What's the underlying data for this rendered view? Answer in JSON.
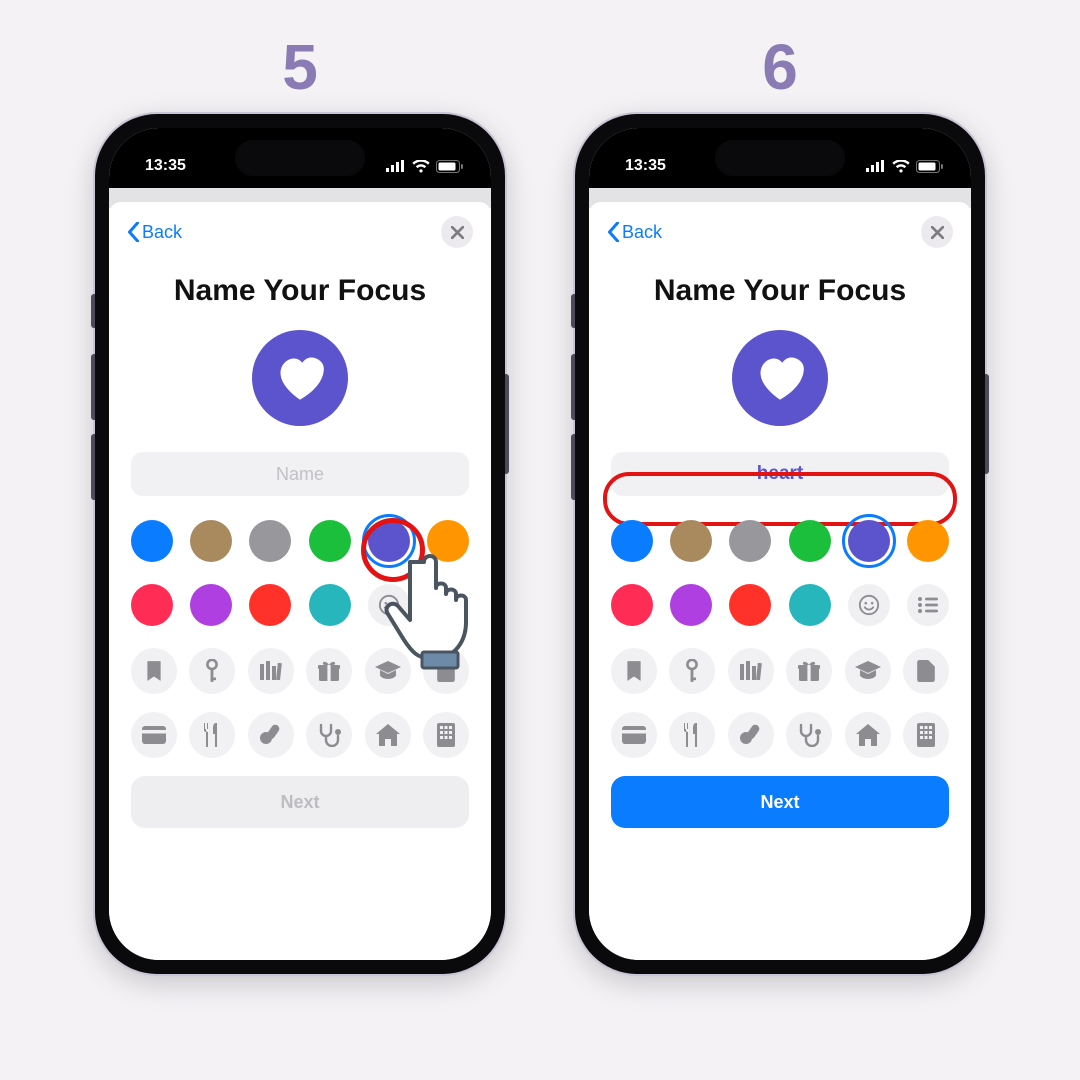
{
  "steps": {
    "left": "5",
    "right": "6"
  },
  "status": {
    "time": "13:35"
  },
  "nav": {
    "back_label": "Back"
  },
  "title": "Name Your Focus",
  "icon_accent": "#5b54cd",
  "name_field": {
    "placeholder": "Name",
    "value_right": "heart"
  },
  "colors_row1": [
    "#0a7cff",
    "#a88a5e",
    "#98989c",
    "#1bbf3c",
    "#5b54cd",
    "#ff9500"
  ],
  "colors_row2": [
    "#ff2d55",
    "#af3fe0",
    "#ff3129",
    "#28b6bd"
  ],
  "selected_color_index": 4,
  "extra_row2_icons": [
    "smiley-icon",
    "list-icon"
  ],
  "glyph_rows": [
    [
      "bookmark-icon",
      "key-icon",
      "books-icon",
      "gift-icon",
      "grad-cap-icon",
      "document-icon"
    ],
    [
      "credit-card-icon",
      "fork-knife-icon",
      "pills-icon",
      "stethoscope-icon",
      "house-icon",
      "building-icon"
    ]
  ],
  "next_label": "Next"
}
